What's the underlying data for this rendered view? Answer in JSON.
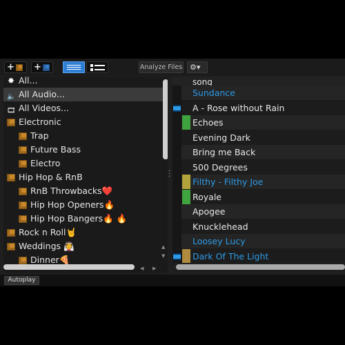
{
  "toolbar": {
    "add_crate_label": "+",
    "add_smart_crate_label": "+",
    "analyze_label": "Analyze Files",
    "settings_caret": "▾"
  },
  "sidebar": {
    "items": [
      {
        "label": "All...",
        "icon": "sparkle-icon",
        "indent": 0,
        "state": "normal"
      },
      {
        "label": "All Audio...",
        "icon": "speaker-icon",
        "indent": 0,
        "state": "selected"
      },
      {
        "label": "All Videos...",
        "icon": "film-icon",
        "indent": 0,
        "state": "normal"
      },
      {
        "label": "Electronic",
        "icon": "crate-icon",
        "indent": 0,
        "state": "normal"
      },
      {
        "label": "Trap",
        "icon": "crate-icon",
        "indent": 1,
        "state": "normal"
      },
      {
        "label": "Future Bass",
        "icon": "crate-icon",
        "indent": 1,
        "state": "normal"
      },
      {
        "label": "Electro",
        "icon": "crate-icon",
        "indent": 1,
        "state": "normal"
      },
      {
        "label": "Hip Hop & RnB",
        "icon": "crate-icon",
        "indent": 0,
        "state": "normal"
      },
      {
        "label": "RnB Throwbacks❤️",
        "icon": "crate-icon",
        "indent": 1,
        "state": "normal"
      },
      {
        "label": "Hip Hop Openers🔥",
        "icon": "crate-icon",
        "indent": 1,
        "state": "normal"
      },
      {
        "label": "Hip Hop Bangers🔥 🔥",
        "icon": "crate-icon",
        "indent": 1,
        "state": "normal"
      },
      {
        "label": "Rock n Roll🤘",
        "icon": "crate-icon",
        "indent": 0,
        "state": "normal"
      },
      {
        "label": "Weddings 👰",
        "icon": "crate-icon",
        "indent": 0,
        "state": "normal"
      },
      {
        "label": "Dinner🍕",
        "icon": "crate-icon",
        "indent": 1,
        "state": "normal"
      }
    ]
  },
  "tracks": {
    "column_header": "song",
    "rows": [
      {
        "title": "Sundance",
        "color": "",
        "video": false,
        "blue": true
      },
      {
        "title": "A - Rose without Rain",
        "color": "",
        "video": true,
        "blue": false
      },
      {
        "title": "Echoes",
        "color": "#3fa33f",
        "video": false,
        "blue": false
      },
      {
        "title": "Evening Dark",
        "color": "",
        "video": false,
        "blue": false
      },
      {
        "title": "Bring me Back",
        "color": "",
        "video": false,
        "blue": false
      },
      {
        "title": "500 Degrees",
        "color": "",
        "video": false,
        "blue": false
      },
      {
        "title": "Filthy - Filthy Joe",
        "color": "#b2a33a",
        "video": false,
        "blue": true
      },
      {
        "title": "Royale",
        "color": "#3fa33f",
        "video": false,
        "blue": false
      },
      {
        "title": "Apogee",
        "color": "",
        "video": false,
        "blue": false
      },
      {
        "title": "Knucklehead",
        "color": "",
        "video": false,
        "blue": false
      },
      {
        "title": "Loosey Lucy",
        "color": "",
        "video": false,
        "blue": true
      },
      {
        "title": "Dark Of The Light",
        "color": "#b08a3e",
        "video": true,
        "blue": true
      }
    ]
  },
  "footer": {
    "autoplay_label": "Autoplay"
  }
}
